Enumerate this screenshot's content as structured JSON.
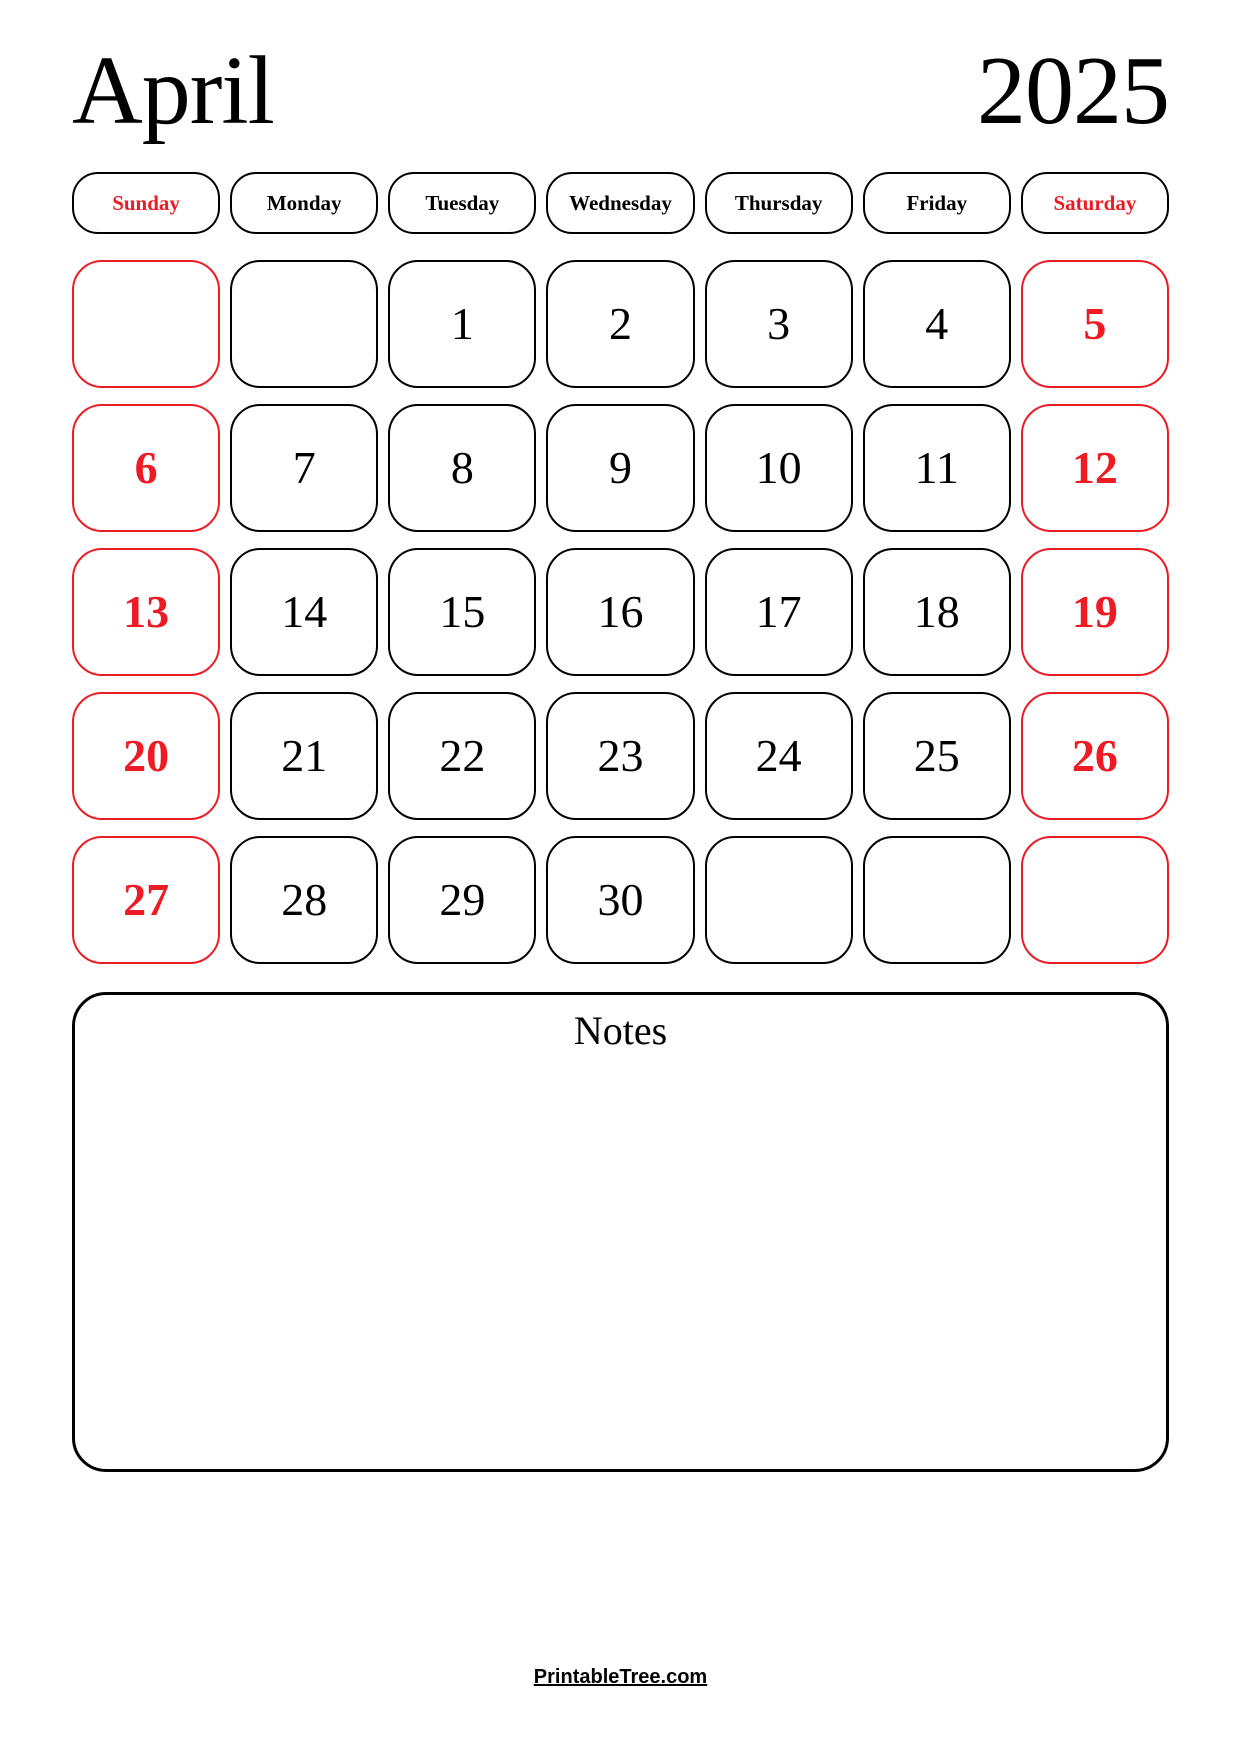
{
  "page": {
    "background_color": "#FFFFFF",
    "accent_red": "#ED1C24",
    "ink_black": "#000000"
  },
  "header": {
    "month": "April",
    "year": "2025"
  },
  "weekdays": [
    {
      "label": "Sunday",
      "weekend": true
    },
    {
      "label": "Monday",
      "weekend": false
    },
    {
      "label": "Tuesday",
      "weekend": false
    },
    {
      "label": "Wednesday",
      "weekend": false
    },
    {
      "label": "Thursday",
      "weekend": false
    },
    {
      "label": "Friday",
      "weekend": false
    },
    {
      "label": "Saturday",
      "weekend": true
    }
  ],
  "weeks": [
    [
      {
        "day": "",
        "weekend": true,
        "empty": true
      },
      {
        "day": "",
        "weekend": false,
        "empty": true
      },
      {
        "day": "1",
        "weekend": false,
        "empty": false
      },
      {
        "day": "2",
        "weekend": false,
        "empty": false
      },
      {
        "day": "3",
        "weekend": false,
        "empty": false
      },
      {
        "day": "4",
        "weekend": false,
        "empty": false
      },
      {
        "day": "5",
        "weekend": true,
        "empty": false
      }
    ],
    [
      {
        "day": "6",
        "weekend": true,
        "empty": false
      },
      {
        "day": "7",
        "weekend": false,
        "empty": false
      },
      {
        "day": "8",
        "weekend": false,
        "empty": false
      },
      {
        "day": "9",
        "weekend": false,
        "empty": false
      },
      {
        "day": "10",
        "weekend": false,
        "empty": false
      },
      {
        "day": "11",
        "weekend": false,
        "empty": false
      },
      {
        "day": "12",
        "weekend": true,
        "empty": false
      }
    ],
    [
      {
        "day": "13",
        "weekend": true,
        "empty": false
      },
      {
        "day": "14",
        "weekend": false,
        "empty": false
      },
      {
        "day": "15",
        "weekend": false,
        "empty": false
      },
      {
        "day": "16",
        "weekend": false,
        "empty": false
      },
      {
        "day": "17",
        "weekend": false,
        "empty": false
      },
      {
        "day": "18",
        "weekend": false,
        "empty": false
      },
      {
        "day": "19",
        "weekend": true,
        "empty": false
      }
    ],
    [
      {
        "day": "20",
        "weekend": true,
        "empty": false
      },
      {
        "day": "21",
        "weekend": false,
        "empty": false
      },
      {
        "day": "22",
        "weekend": false,
        "empty": false
      },
      {
        "day": "23",
        "weekend": false,
        "empty": false
      },
      {
        "day": "24",
        "weekend": false,
        "empty": false
      },
      {
        "day": "25",
        "weekend": false,
        "empty": false
      },
      {
        "day": "26",
        "weekend": true,
        "empty": false
      }
    ],
    [
      {
        "day": "27",
        "weekend": true,
        "empty": false
      },
      {
        "day": "28",
        "weekend": false,
        "empty": false
      },
      {
        "day": "29",
        "weekend": false,
        "empty": false
      },
      {
        "day": "30",
        "weekend": false,
        "empty": false
      },
      {
        "day": "",
        "weekend": false,
        "empty": true
      },
      {
        "day": "",
        "weekend": false,
        "empty": true
      },
      {
        "day": "",
        "weekend": true,
        "empty": true
      }
    ]
  ],
  "notes": {
    "title": "Notes",
    "content": ""
  },
  "footer": {
    "link_text": "PrintableTree.com"
  }
}
